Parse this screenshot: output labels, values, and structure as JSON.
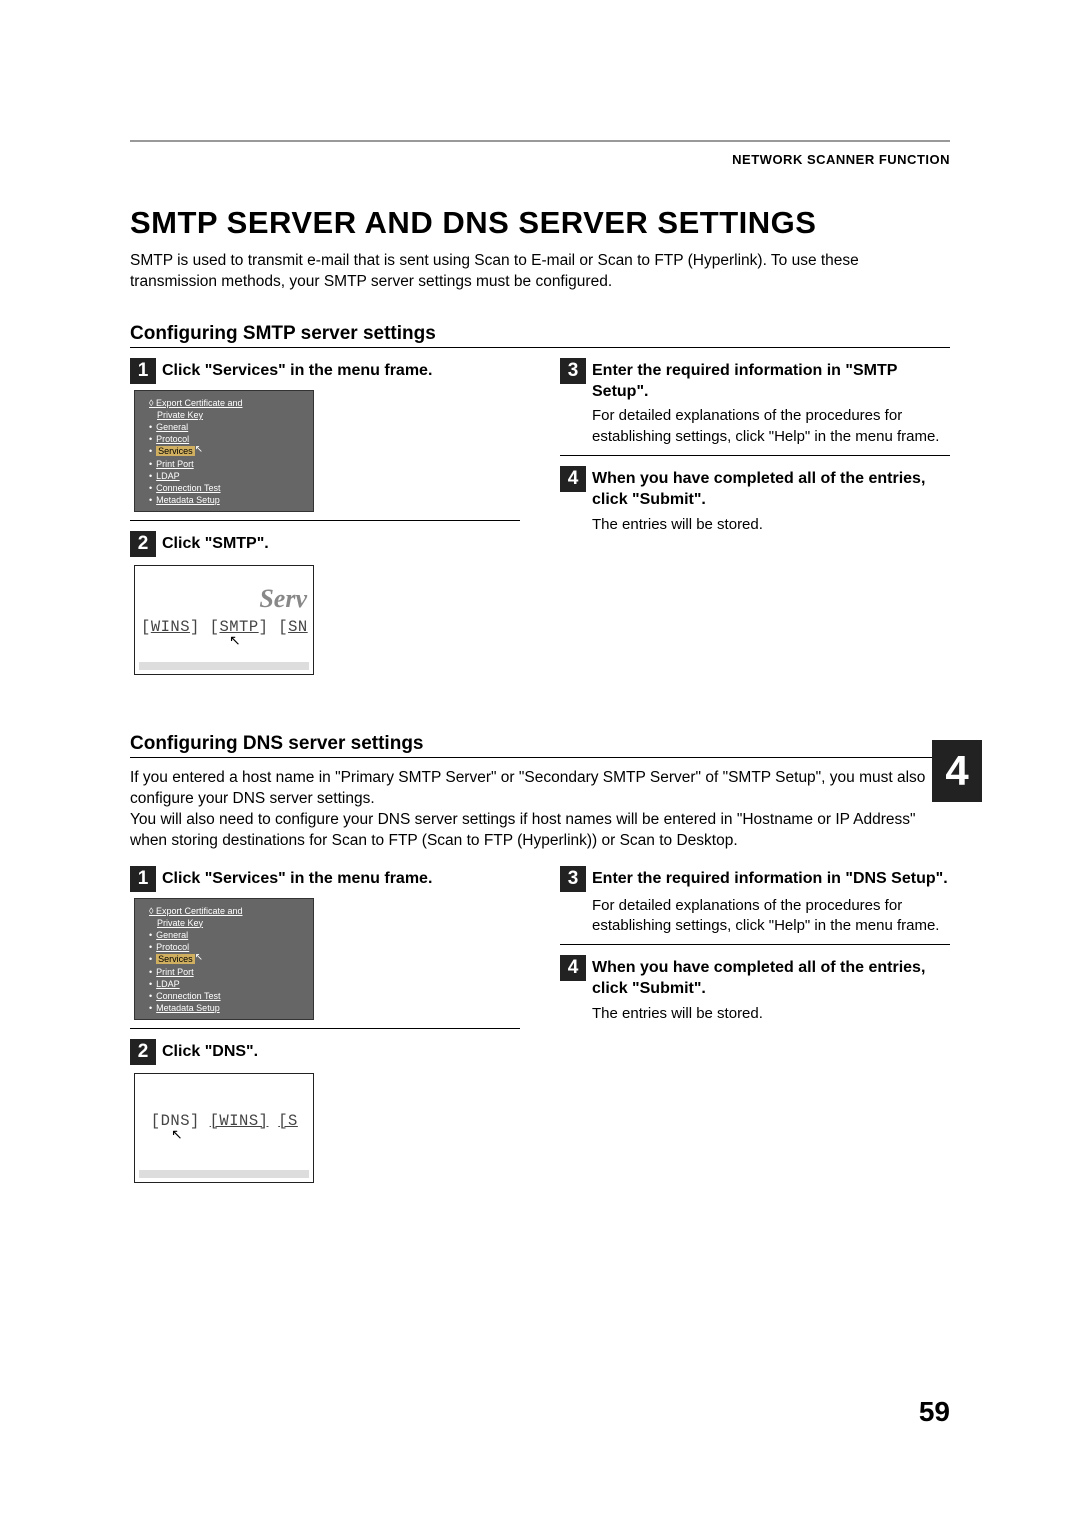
{
  "header": {
    "label": "NETWORK SCANNER FUNCTION"
  },
  "title": "SMTP SERVER AND DNS SERVER SETTINGS",
  "intro": "SMTP is used to transmit e-mail that is sent using Scan to E-mail or Scan to FTP (Hyperlink). To use these transmission methods, your SMTP server settings must be configured.",
  "smtp": {
    "heading": "Configuring SMTP server settings",
    "steps": [
      {
        "num": "1",
        "title": "Click \"Services\" in the menu frame."
      },
      {
        "num": "2",
        "title": "Click \"SMTP\"."
      },
      {
        "num": "3",
        "title": "Enter the required information in \"SMTP Setup\".",
        "body": "For detailed explanations of the procedures for establishing settings, click \"Help\" in the menu frame."
      },
      {
        "num": "4",
        "title": "When you have completed all of the entries, click \"Submit\".",
        "body": "The entries will be stored."
      }
    ]
  },
  "dns": {
    "heading": "Configuring DNS server settings",
    "intro": "If you entered a host name in \"Primary SMTP Server\" or \"Secondary SMTP Server\" of \"SMTP Setup\", you must also configure your DNS server settings.\nYou will also need to configure your DNS server settings if host names will be entered in \"Hostname or IP Address\" when storing destinations for Scan to FTP (Scan to FTP (Hyperlink)) or Scan to Desktop.",
    "steps": [
      {
        "num": "1",
        "title": "Click \"Services\" in the menu frame."
      },
      {
        "num": "2",
        "title": "Click \"DNS\"."
      },
      {
        "num": "3",
        "title": "Enter the required information in \"DNS Setup\".",
        "body": "For detailed explanations of the procedures for establishing settings, click \"Help\" in the menu frame."
      },
      {
        "num": "4",
        "title": "When you have completed all of the entries, click \"Submit\".",
        "body": "The entries will be stored."
      }
    ]
  },
  "menu": {
    "items": [
      "Export Certificate and",
      "Private Key",
      "General",
      "Protocol",
      "Services",
      "Print Port",
      "LDAP",
      "Connection Test",
      "Metadata Setup"
    ]
  },
  "serv_shot_smtp": {
    "title": "Serv",
    "links": "[WINS] [SMTP] [SN"
  },
  "serv_shot_dns": {
    "links": "[DNS] [WINS] [S"
  },
  "chapter": "4",
  "page_number": "59"
}
